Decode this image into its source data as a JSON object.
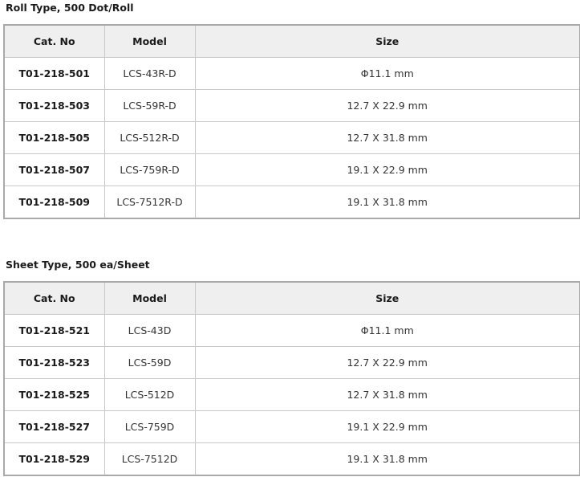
{
  "roll_section": {
    "title": "Roll Type, 500 Dot/Roll",
    "headers": [
      "Cat. No",
      "Model",
      "Size"
    ],
    "rows": [
      {
        "cat_no": "T01-218-501",
        "model": "LCS-43R-D",
        "size": "Φ11.1 mm"
      },
      {
        "cat_no": "T01-218-503",
        "model": "LCS-59R-D",
        "size": "12.7 X 22.9 mm"
      },
      {
        "cat_no": "T01-218-505",
        "model": "LCS-512R-D",
        "size": "12.7 X 31.8 mm"
      },
      {
        "cat_no": "T01-218-507",
        "model": "LCS-759R-D",
        "size": "19.1 X 22.9 mm"
      },
      {
        "cat_no": "T01-218-509",
        "model": "LCS-7512R-D",
        "size": "19.1 X 31.8 mm"
      }
    ]
  },
  "sheet_section": {
    "title": "Sheet Type, 500 ea/Sheet",
    "headers": [
      "Cat. No",
      "Model",
      "Size"
    ],
    "rows": [
      {
        "cat_no": "T01-218-521",
        "model": "LCS-43D",
        "size": "Φ11.1 mm"
      },
      {
        "cat_no": "T01-218-523",
        "model": "LCS-59D",
        "size": "12.7 X 22.9 mm"
      },
      {
        "cat_no": "T01-218-525",
        "model": "LCS-512D",
        "size": "12.7 X 31.8 mm"
      },
      {
        "cat_no": "T01-218-527",
        "model": "LCS-759D",
        "size": "19.1 X 22.9 mm"
      },
      {
        "cat_no": "T01-218-529",
        "model": "LCS-7512D",
        "size": "19.1 X 31.8 mm"
      }
    ]
  }
}
